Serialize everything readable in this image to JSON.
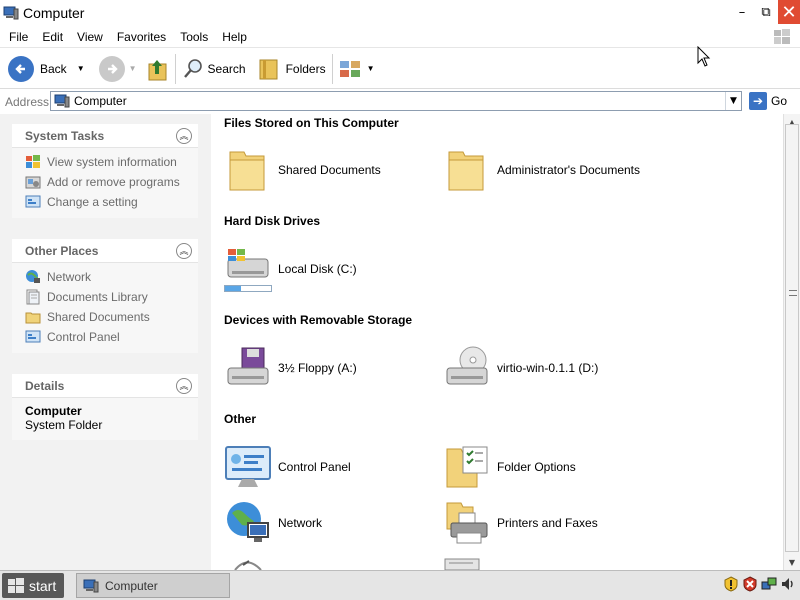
{
  "window": {
    "title": "Computer",
    "buttons": {
      "minimize": "–",
      "restore": "⧉",
      "close": "✕"
    }
  },
  "menu": [
    "File",
    "Edit",
    "View",
    "Favorites",
    "Tools",
    "Help"
  ],
  "toolbar": {
    "back_label": "Back",
    "search_label": "Search",
    "folders_label": "Folders"
  },
  "address": {
    "label": "Address",
    "value": "Computer",
    "go_label": "Go"
  },
  "left_pane": {
    "system_tasks": {
      "title": "System Tasks",
      "items": [
        {
          "label": "View system information",
          "icon": "system-info-icon"
        },
        {
          "label": "Add or remove programs",
          "icon": "add-remove-programs-icon"
        },
        {
          "label": "Change a setting",
          "icon": "control-panel-icon"
        }
      ]
    },
    "other_places": {
      "title": "Other Places",
      "items": [
        {
          "label": "Network",
          "icon": "network-icon"
        },
        {
          "label": "Documents Library",
          "icon": "documents-library-icon"
        },
        {
          "label": "Shared Documents",
          "icon": "folder-icon"
        },
        {
          "label": "Control Panel",
          "icon": "control-panel-icon"
        }
      ]
    },
    "details": {
      "title": "Details",
      "name": "Computer",
      "type": "System Folder"
    }
  },
  "content": {
    "groups": [
      {
        "title": "Files Stored on This Computer",
        "items": [
          {
            "label": "Shared Documents",
            "icon": "folder-icon"
          },
          {
            "label": "Administrator's Documents",
            "icon": "folder-icon"
          }
        ]
      },
      {
        "title": "Hard Disk Drives",
        "items": [
          {
            "label": "Local Disk (C:)",
            "icon": "hard-disk-icon",
            "usage_fraction": 0.35
          }
        ]
      },
      {
        "title": "Devices with Removable Storage",
        "items": [
          {
            "label": "3½ Floppy (A:)",
            "icon": "floppy-drive-icon"
          },
          {
            "label": "virtio-win-0.1.1 (D:)",
            "icon": "cd-drive-icon"
          }
        ]
      },
      {
        "title": "Other",
        "items": [
          {
            "label": "Control Panel",
            "icon": "control-panel-icon"
          },
          {
            "label": "Folder Options",
            "icon": "folder-options-icon"
          },
          {
            "label": "Network",
            "icon": "network-globe-icon"
          },
          {
            "label": "Printers and Faxes",
            "icon": "printer-icon"
          }
        ]
      }
    ]
  },
  "taskbar": {
    "start_label": "start",
    "task_label": "Computer"
  },
  "colors": {
    "close_button": "#e04b32",
    "left_pane_bg": "#f2f2f2",
    "start_button": "#585858"
  }
}
